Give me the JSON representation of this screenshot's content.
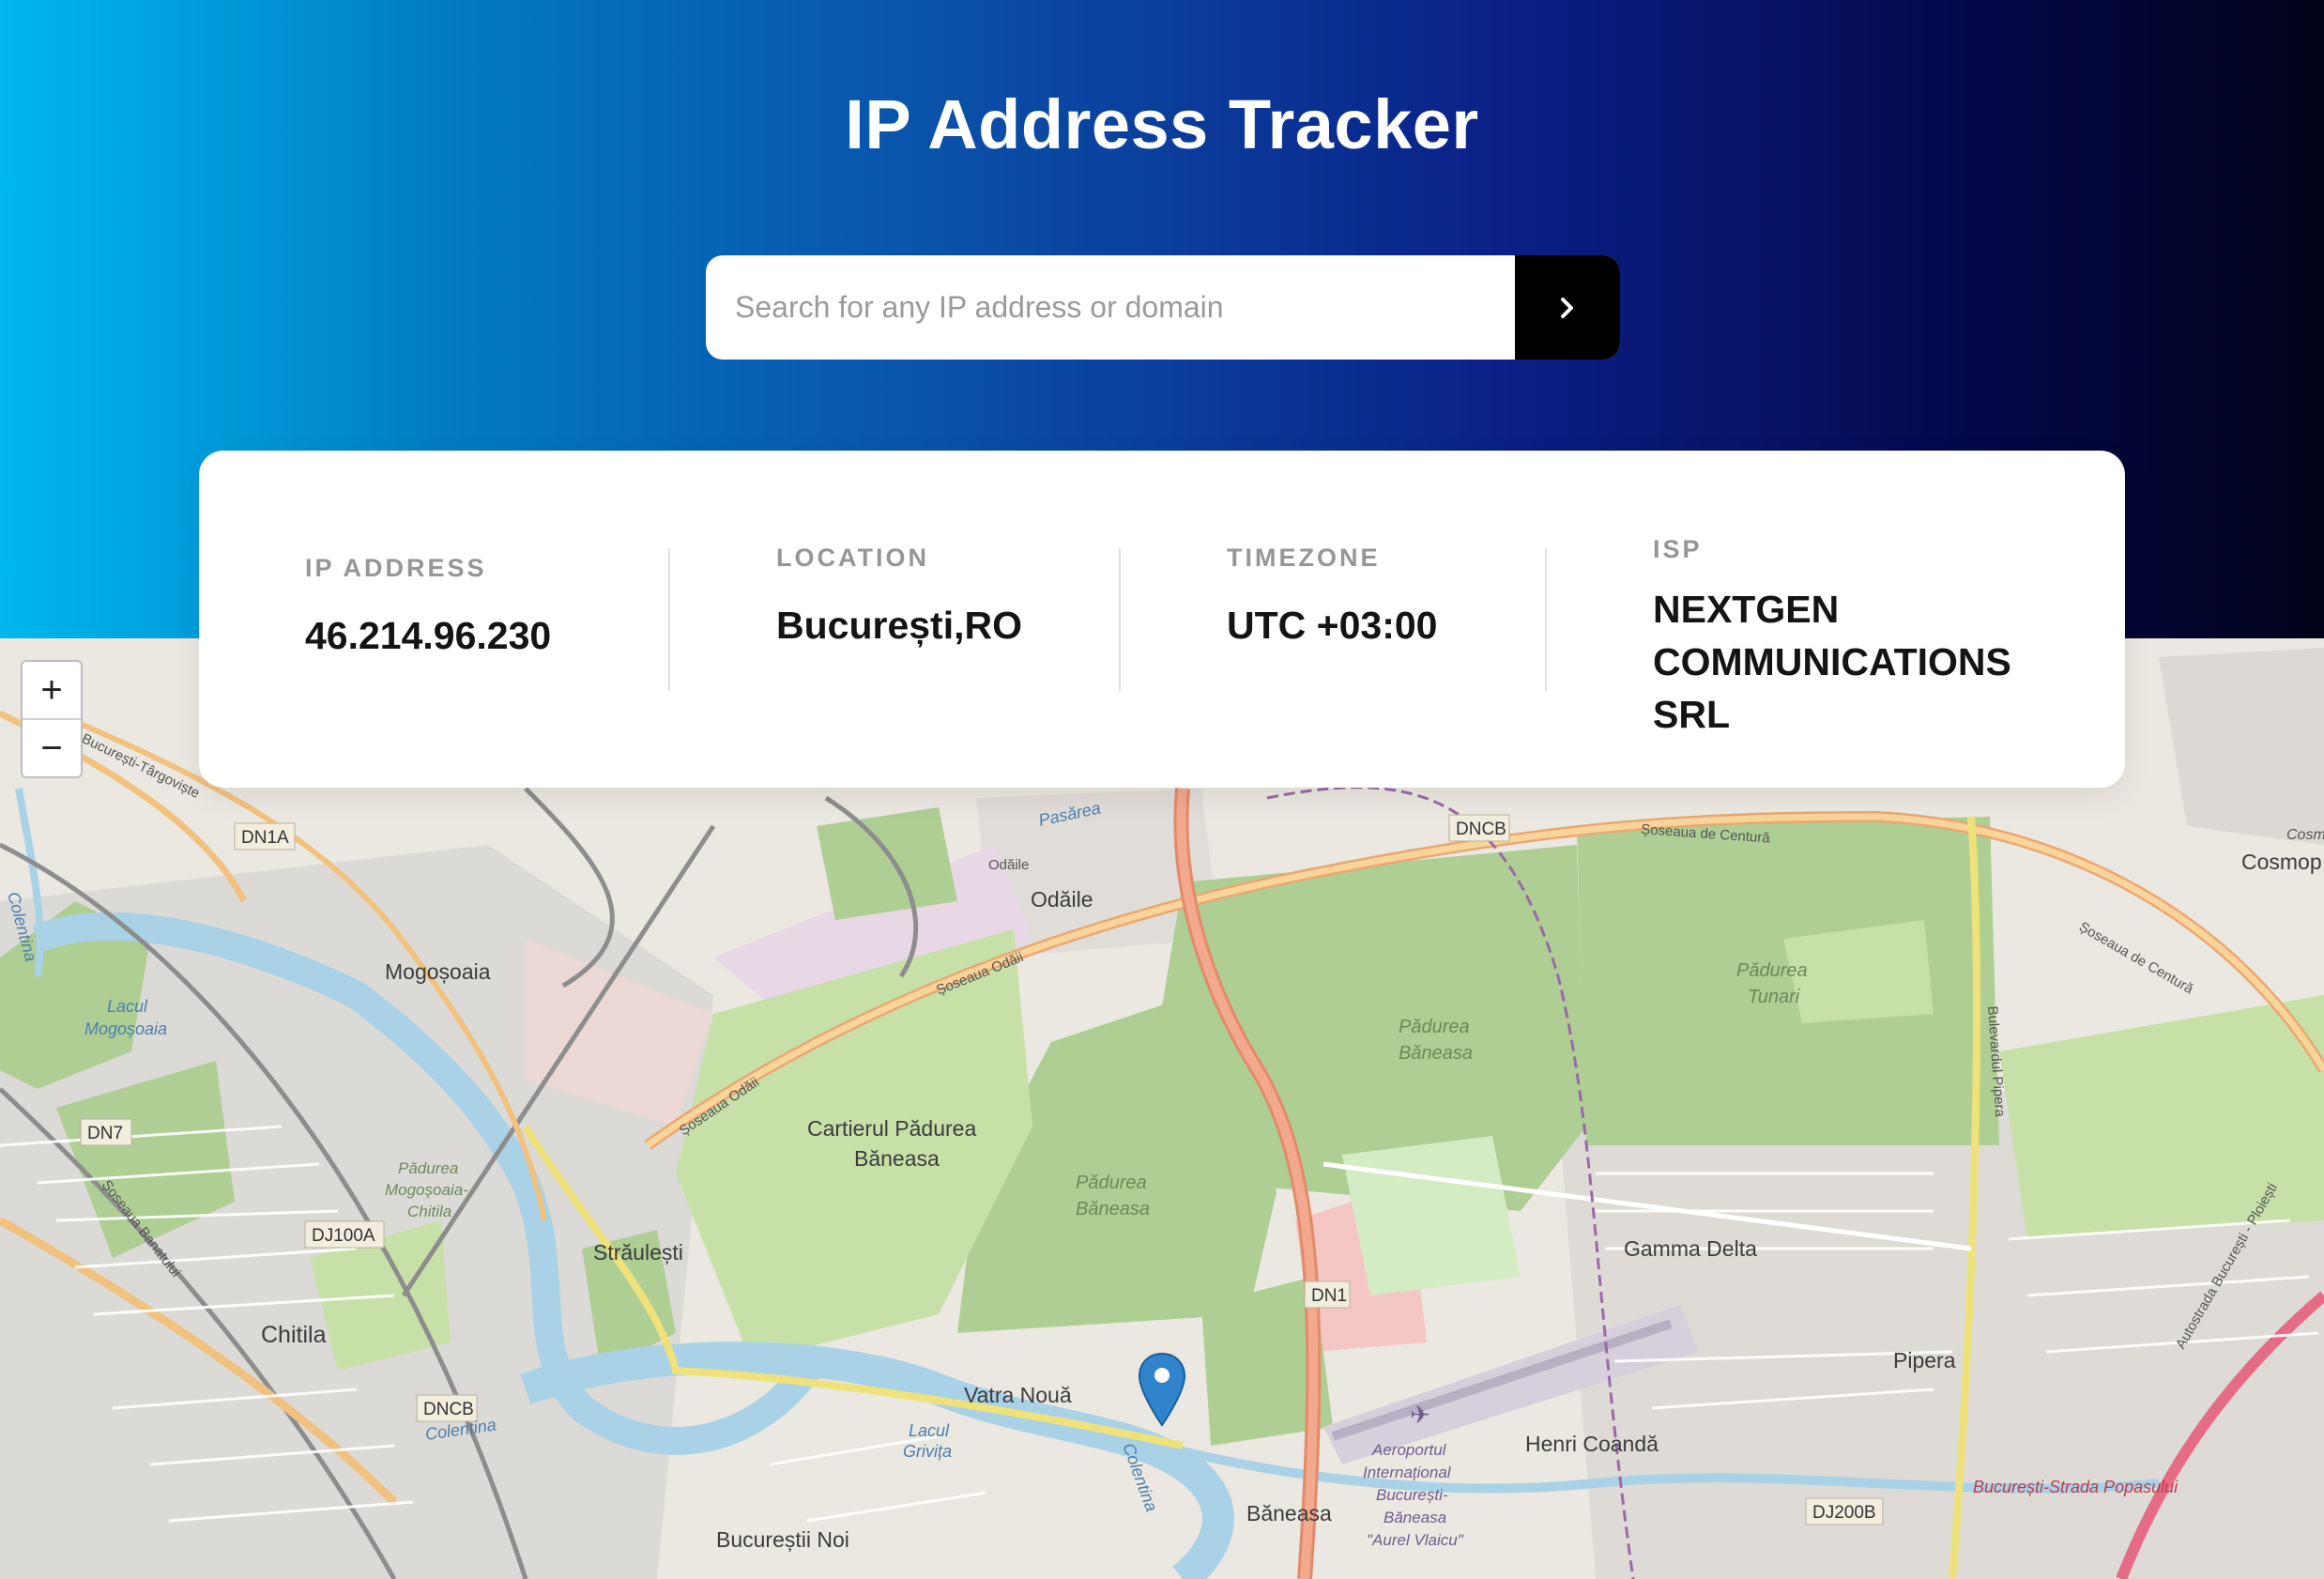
{
  "header": {
    "title": "IP Address Tracker"
  },
  "search": {
    "placeholder": "Search for any IP address or domain",
    "button_icon": "chevron-right-icon"
  },
  "info": {
    "ip": {
      "label": "IP ADDRESS",
      "value": "46.214.96.230"
    },
    "location": {
      "label": "LOCATION",
      "value": "București,RO"
    },
    "timezone": {
      "label": "TIMEZONE",
      "value": "UTC +03:00"
    },
    "isp": {
      "label": "ISP",
      "lines": [
        "NEXTGEN",
        "COMMUNICATIONS",
        "SRL"
      ]
    }
  },
  "map": {
    "zoom_in": "+",
    "zoom_out": "−",
    "marker_icon": "map-marker-icon",
    "labels": {
      "dn1a": "DN1A",
      "dncb1": "DNCB",
      "dncb2": "DNCB",
      "dn7": "DN7",
      "dj100a": "DJ100A",
      "dn1": "DN1",
      "dj200b": "DJ200B",
      "mogosoaia": "Mogoșoaia",
      "lacul": "Lacul",
      "mogosoaia2": "Mogoșoaia",
      "odaile_small": "Odăile",
      "odaile": "Odăile",
      "pasarea": "Pasărea",
      "padurea_baneasa_1a": "Pădurea",
      "padurea_baneasa_1b": "Băneasa",
      "padurea_tunari_a": "Pădurea",
      "padurea_tunari_b": "Tunari",
      "cartierul_a": "Cartierul Pădurea",
      "cartierul_b": "Băneasa",
      "padurea_baneasa_2a": "Pădurea",
      "padurea_baneasa_2b": "Băneasa",
      "padurea_mog_a": "Pădurea",
      "padurea_mog_b": "Mogoșoaia-",
      "padurea_mog_c": "Chitila",
      "straulesti": "Străulești",
      "chitila": "Chitila",
      "vatra_noua": "Vatra Nouă",
      "lacul_grivita_a": "Lacul",
      "lacul_grivita_b": "Grivița",
      "bucurestii_noi": "Bucureștii Noi",
      "baneasa": "Băneasa",
      "gamma_delta": "Gamma Delta",
      "pipera": "Pipera",
      "henri_coanda": "Henri Coandă",
      "aeroport_a": "Aeroportul",
      "aeroport_b": "Internațional",
      "aeroport_c": "București-",
      "aeroport_d": "Băneasa",
      "aeroport_e": "\"Aurel Vlaicu\"",
      "cosmop_a": "Cosmop",
      "cosmop_b": "Cosmop",
      "soseaua_odaii_a": "Șoseaua Odăii",
      "soseaua_odaii_b": "Șoseaua Odăii",
      "soseaua_centura_a": "Șoseaua de Centură",
      "soseaua_centura_b": "Șoseaua de Centură",
      "soseaua_banatului": "Șoseaua Banatului",
      "buc_targoviste": "București-Târgoviște",
      "bulevardul_pipera": "Bulevardul Pipera",
      "autostrada": "Autostrada București - Ploiești",
      "buc_strada": "București-Strada Popasului",
      "colentina_a": "Colentina",
      "colentina_b": "Colentina",
      "colentina_c": "Colentina"
    }
  }
}
